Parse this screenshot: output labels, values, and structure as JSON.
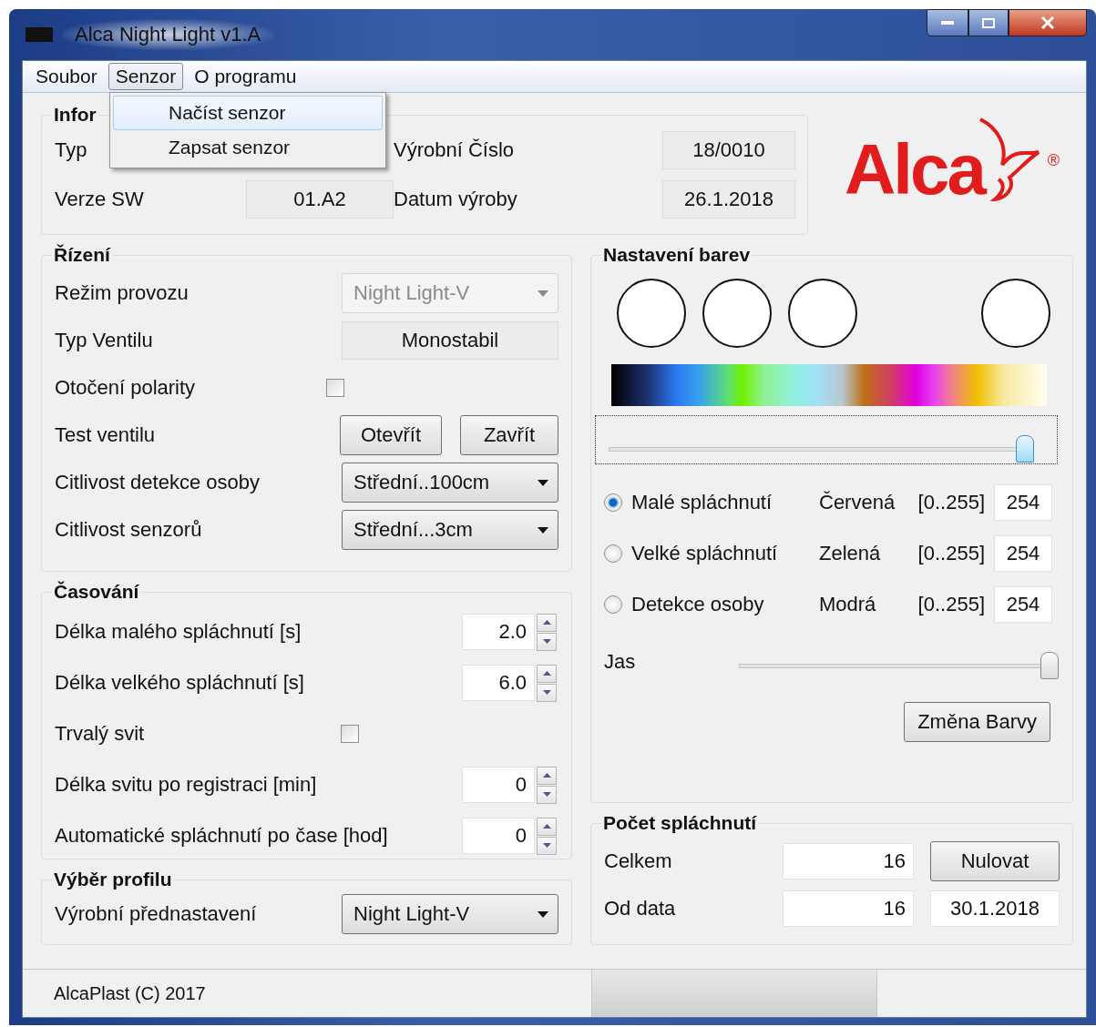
{
  "window": {
    "title": "Alca Night Light  v1.A"
  },
  "menu": [
    {
      "label": "Soubor",
      "selected": false
    },
    {
      "label": "Senzor",
      "selected": true
    },
    {
      "label": "O programu",
      "selected": false
    }
  ],
  "dropdown": [
    {
      "label": "Načíst senzor",
      "selected": true
    },
    {
      "label": "Zapsat senzor",
      "selected": false
    }
  ],
  "info": {
    "title": "Infor",
    "fields": [
      {
        "label": "Typ"
      },
      {
        "label": "Výrobní Číslo",
        "value": "18/0010"
      },
      {
        "label": "Verze SW",
        "value": "01.A2"
      },
      {
        "label": "Datum výroby",
        "value": "26.1.2018"
      }
    ]
  },
  "logo": {
    "text": "Alca",
    "mark": "®"
  },
  "control": {
    "title": "Řízení",
    "rows": [
      {
        "kind": "select",
        "label": "Režim provozu",
        "value": "Night Light-V",
        "disabled": true
      },
      {
        "kind": "display",
        "label": "Typ Ventilu",
        "value": "Monostabil"
      },
      {
        "kind": "checkbox",
        "label": "Otočení polarity",
        "checked": false
      },
      {
        "kind": "buttons",
        "label": "Test ventilu",
        "buttons": [
          "Otevřít",
          "Zavřít"
        ]
      },
      {
        "kind": "select",
        "label": "Citlivost detekce osoby",
        "value": "Střední..100cm",
        "disabled": false
      },
      {
        "kind": "select",
        "label": "Citlivost senzorů",
        "value": "Střední...3cm",
        "disabled": false
      }
    ]
  },
  "timing": {
    "title": "Časování",
    "rows": [
      {
        "kind": "spinner",
        "label": "Délka malého spláchnutí [s]",
        "value": "2.0"
      },
      {
        "kind": "spinner",
        "label": "Délka velkého spláchnutí [s]",
        "value": "6.0"
      },
      {
        "kind": "checkbox",
        "label": "Trvalý svit",
        "checked": false
      },
      {
        "kind": "spinner",
        "label": "Délka svitu po registraci [min]",
        "value": "0"
      },
      {
        "kind": "spinner",
        "label": "Automatické spláchnutí po čase [hod]",
        "value": "0"
      }
    ]
  },
  "profile": {
    "title": "Výběr profilu",
    "label": "Výrobní přednastavení",
    "value": "Night Light-V"
  },
  "colors": {
    "title": "Nastavení barev",
    "hue": {
      "level": 1.0
    },
    "modes": [
      {
        "label": "Malé spláchnutí",
        "selected": true
      },
      {
        "label": "Velké spláchnutí",
        "selected": false
      },
      {
        "label": "Detekce osoby",
        "selected": false
      }
    ],
    "channels": [
      {
        "name": "Červená",
        "range": "[0..255]",
        "value": "254"
      },
      {
        "name": "Zelená",
        "range": "[0..255]",
        "value": "254"
      },
      {
        "name": "Modrá",
        "range": "[0..255]",
        "value": "254"
      }
    ],
    "brightness": {
      "label": "Jas",
      "level": 1.0
    },
    "button": "Změna Barvy"
  },
  "counts": {
    "title": "Počet spláchnutí",
    "rows": [
      {
        "label": "Celkem",
        "value": "16",
        "button": "Nulovat"
      },
      {
        "label": "Od data",
        "value": "16",
        "date": "30.1.2018"
      }
    ]
  },
  "status": {
    "text": "AlcaPlast   (C) 2017"
  }
}
